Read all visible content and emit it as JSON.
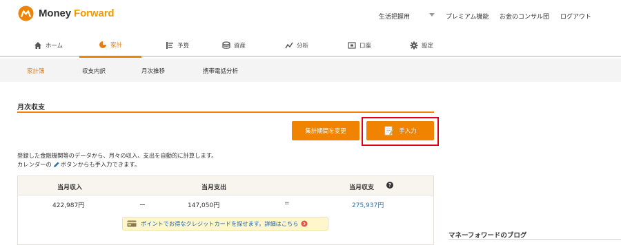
{
  "brand": {
    "name_part1": "Money",
    "name_part2": "Forward",
    "accent": "#f08300"
  },
  "header": {
    "select_label": "生活把握用",
    "premium": "プレミアム機能",
    "consul": "お金のコンサル団",
    "logout": "ログアウト"
  },
  "nav": {
    "items": [
      {
        "label": "ホーム",
        "icon": "home-icon"
      },
      {
        "label": "家計",
        "icon": "pie-chart-icon"
      },
      {
        "label": "予算",
        "icon": "budget-icon"
      },
      {
        "label": "資産",
        "icon": "assets-icon"
      },
      {
        "label": "分析",
        "icon": "analysis-icon"
      },
      {
        "label": "口座",
        "icon": "account-icon"
      },
      {
        "label": "設定",
        "icon": "gear-icon"
      }
    ],
    "active": "家計"
  },
  "subnav": {
    "items": [
      "家計簿",
      "収支内訳",
      "月次推移",
      "携帯電話分析"
    ],
    "active": "家計簿"
  },
  "section": {
    "title": "月次収支",
    "change_period_button": "集計期間を変更",
    "manual_input_button": "手入力",
    "desc_line1": "登録した金融機関等のデータから、月々の収入、支出を自動的に計算します。",
    "desc_line2_a": "カレンダーの",
    "desc_line2_b": "ボタンからも手入力できます。"
  },
  "summary": {
    "income_header": "当月収入",
    "expense_header": "当月支出",
    "balance_header": "当月収支",
    "help": "?",
    "income_value": "422,987円",
    "minus": "ー",
    "expense_value": "147,050円",
    "equal": "=",
    "balance_value": "275,937円",
    "promo_text": "ポイントでお得なクレジットカードを探せます。詳細はこちら"
  },
  "sidebar": {
    "blog_title": "マネーフォワードのブログ"
  }
}
